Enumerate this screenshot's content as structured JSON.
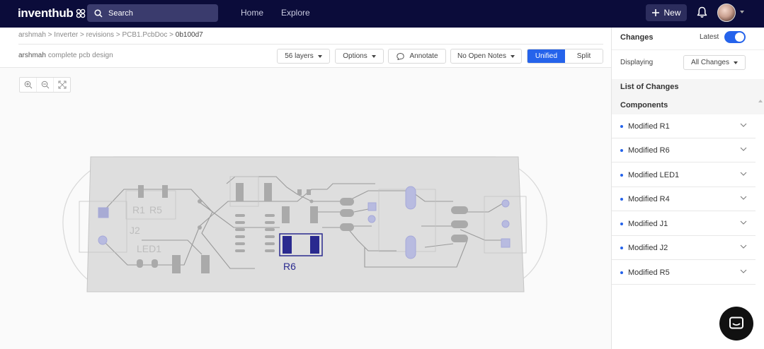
{
  "topbar": {
    "logo_text": "inventhub",
    "search_label": "Search",
    "nav": [
      "Home",
      "Explore"
    ],
    "new_label": "New"
  },
  "breadcrumb": {
    "path": "arshmah > Inverter > revisions > PCB1.PcbDoc > ",
    "current": "0b100d7"
  },
  "commit": {
    "author": "arshmah",
    "message": "complete pcb design"
  },
  "toolbar": {
    "layers": "56 layers",
    "options": "Options",
    "annotate": "Annotate",
    "notes": "No Open Notes",
    "unified": "Unified",
    "split": "Split"
  },
  "pcb": {
    "designators": [
      "R1",
      "R5",
      "J2",
      "LED1",
      "R6"
    ],
    "highlight_color": "#2a2a8f"
  },
  "panel": {
    "title": "Changes",
    "latest_label": "Latest",
    "latest_on": true,
    "displaying_label": "Displaying",
    "displaying_value": "All Changes",
    "list_title": "List of Changes",
    "section": "Components",
    "items": [
      "Modified R1",
      "Modified R6",
      "Modified LED1",
      "Modified R4",
      "Modified J1",
      "Modified J2",
      "Modified R5"
    ]
  },
  "colors": {
    "topbar": "#0b0c3a",
    "accent": "#2563eb"
  }
}
